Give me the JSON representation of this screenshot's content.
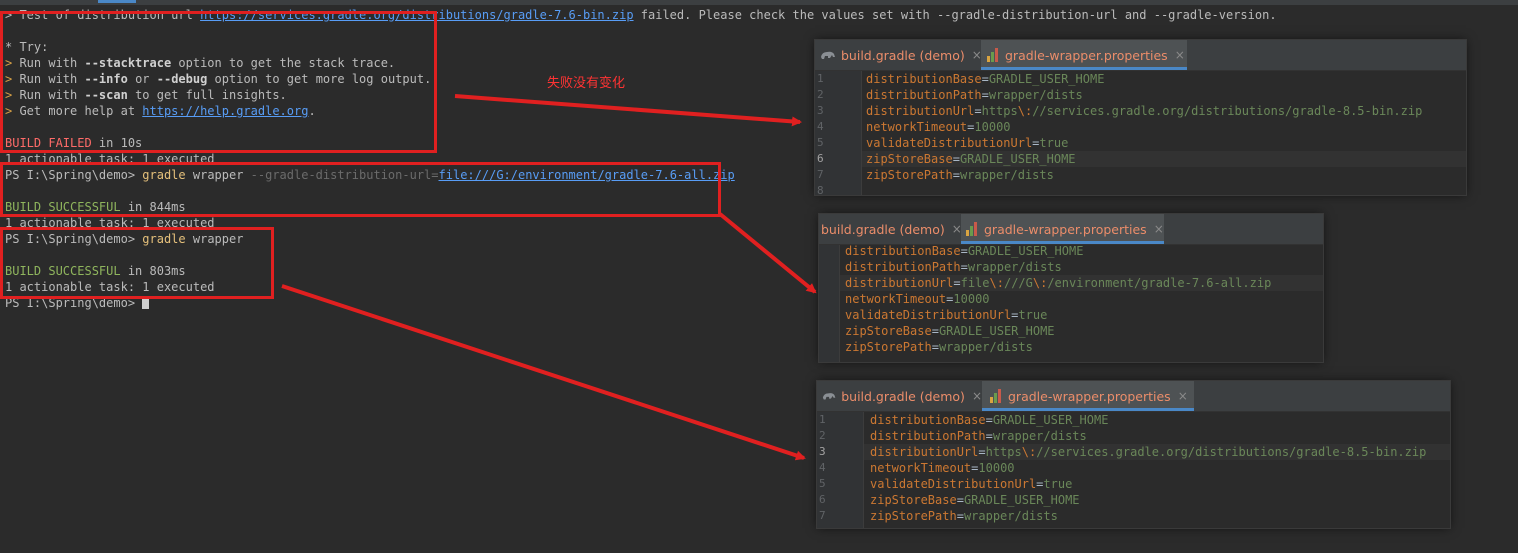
{
  "terminal": {
    "lines": [
      {
        "pre": "> Test of distribution url ",
        "link": "https://services.gradle.org/distributions/gradle-7.6-bin.zip",
        "post": " failed. Please check the values set with --gradle-distribution-url and --gradle-version."
      },
      "* Try:",
      {
        "mark": "> ",
        "a": "Run with ",
        "b": "--stacktrace",
        "c": " option to get the stack trace."
      },
      {
        "mark": "> ",
        "a": "Run with ",
        "b": "--info",
        "m": " or ",
        "b2": "--debug",
        "c": " option to get more log output."
      },
      {
        "mark": "> ",
        "a": "Run with ",
        "b": "--scan",
        "c": " to get full insights."
      },
      {
        "mark": "> ",
        "a": "Get more help at ",
        "link": "https://help.gradle.org",
        "c": "."
      },
      {
        "status": "BUILD FAILED",
        "rest": " in 10s"
      },
      "1 actionable task: 1 executed",
      {
        "prompt": "PS I:\\Spring\\demo> ",
        "cmd": "gradle",
        "arg": " wrapper",
        "opt": " --gradle-distribution-url=",
        "link": "file:///G:/environment/gradle-7.6-all.zip"
      },
      {
        "status": "BUILD SUCCESSFUL",
        "rest": " in 844ms"
      },
      "1 actionable task: 1 executed",
      {
        "prompt": "PS I:\\Spring\\demo> ",
        "cmd": "gradle",
        "arg": " wrapper"
      },
      {
        "status": "BUILD SUCCESSFUL",
        "rest": " in 803ms"
      },
      "1 actionable task: 1 executed",
      {
        "prompt": "PS I:\\Spring\\demo> "
      }
    ]
  },
  "annotation": "失败没有变化",
  "tabs": {
    "build_gradle": "build.gradle (demo)",
    "wrapper_props": "gradle-wrapper.properties",
    "close": "×"
  },
  "panel1": {
    "line_numbers": [
      "1",
      "2",
      "3",
      "4",
      "5",
      "6",
      "7",
      "8"
    ],
    "lines": [
      {
        "k": "distributionBase",
        "v": "GRADLE_USER_HOME"
      },
      {
        "k": "distributionPath",
        "v": "wrapper/dists"
      },
      {
        "k": "distributionUrl",
        "v1": "https",
        "esc": "\\:",
        "v2": "//services.gradle.org/distributions/gradle-8.5-bin.zip"
      },
      {
        "k": "networkTimeout",
        "v": "10000"
      },
      {
        "k": "validateDistributionUrl",
        "v": "true"
      },
      {
        "k": "zipStoreBase",
        "v": "GRADLE_USER_HOME"
      },
      {
        "k": "zipStorePath",
        "v": "wrapper/dists"
      }
    ]
  },
  "panel2": {
    "lines": [
      {
        "k": "distributionBase",
        "v": "GRADLE_USER_HOME"
      },
      {
        "k": "distributionPath",
        "v": "wrapper/dists"
      },
      {
        "k": "distributionUrl",
        "v1": "file",
        "esc": "\\:",
        "v2": "///G",
        "esc2": "\\:",
        "v3": "/environment/gradle-7.6-all.zip"
      },
      {
        "k": "networkTimeout",
        "v": "10000"
      },
      {
        "k": "validateDistributionUrl",
        "v": "true"
      },
      {
        "k": "zipStoreBase",
        "v": "GRADLE_USER_HOME"
      },
      {
        "k": "zipStorePath",
        "v": "wrapper/dists"
      }
    ]
  },
  "panel3": {
    "line_numbers": [
      "1",
      "2",
      "3",
      "4",
      "5",
      "6",
      "7"
    ],
    "lines": [
      {
        "k": "distributionBase",
        "v": "GRADLE_USER_HOME"
      },
      {
        "k": "distributionPath",
        "v": "wrapper/dists"
      },
      {
        "k": "distributionUrl",
        "v1": "https",
        "esc": "\\:",
        "v2": "//services.gradle.org/distributions/gradle-8.5-bin.zip"
      },
      {
        "k": "networkTimeout",
        "v": "10000"
      },
      {
        "k": "validateDistributionUrl",
        "v": "true"
      },
      {
        "k": "zipStoreBase",
        "v": "GRADLE_USER_HOME"
      },
      {
        "k": "zipStorePath",
        "v": "wrapper/dists"
      }
    ]
  },
  "colors": {
    "annotation_red": "#e02020",
    "key": "#cc7832",
    "value": "#6a8759",
    "fail": "#ff6b68",
    "success": "#8fb55d"
  }
}
